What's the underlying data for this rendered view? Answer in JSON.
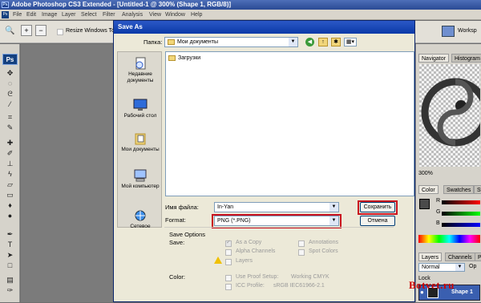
{
  "window": {
    "title": "Adobe Photoshop CS3 Extended - [Untitled-1 @ 300% (Shape 1, RGB/8)]"
  },
  "menu": [
    "File",
    "Edit",
    "Image",
    "Layer",
    "Select",
    "Filter",
    "Analysis",
    "View",
    "Window",
    "Help"
  ],
  "optbar": {
    "resize_label": "Resize Windows To F",
    "workspace_label": "Worksp"
  },
  "toolbox": {
    "badge": "Ps"
  },
  "panels": {
    "navigator_tab": "Navigator",
    "histogram_tab": "Histogram",
    "zoom": "300%",
    "color_tab": "Color",
    "swatches_tab": "Swatches",
    "styles_tab": "St",
    "channels": [
      "R",
      "G",
      "B"
    ],
    "layers_tab": "Layers",
    "channels_tab": "Channels",
    "paths_tab": "P",
    "blend_mode": "Normal",
    "opacity_short": "Op",
    "lock_label": "Lock",
    "layer_name": "Shape 1"
  },
  "dialog": {
    "title": "Save As",
    "folder_label": "Папка:",
    "folder_value": "Мои документы",
    "files": [
      "Загрузки"
    ],
    "places": [
      "Недавние документы",
      "Рабочий стол",
      "Мои документы",
      "Мой компьютер",
      "Сетевое"
    ],
    "filename_label": "Имя файла:",
    "filename_value": "In-Yan",
    "format_label": "Format:",
    "format_value": "PNG (*.PNG)",
    "save_button": "Сохранить",
    "cancel_button": "Отмена",
    "save_options_title": "Save Options",
    "save_label": "Save:",
    "options": {
      "as_copy": "As a Copy",
      "alpha": "Alpha Channels",
      "layers": "Layers",
      "annotations": "Annotations",
      "spot": "Spot Colors"
    },
    "color_label": "Color:",
    "proof": "Use Proof Setup:",
    "proof_value": "Working CMYK",
    "icc": "ICC Profile:",
    "icc_value": "sRGB IEC61966-2.1"
  },
  "watermark": "Botvet.ru"
}
